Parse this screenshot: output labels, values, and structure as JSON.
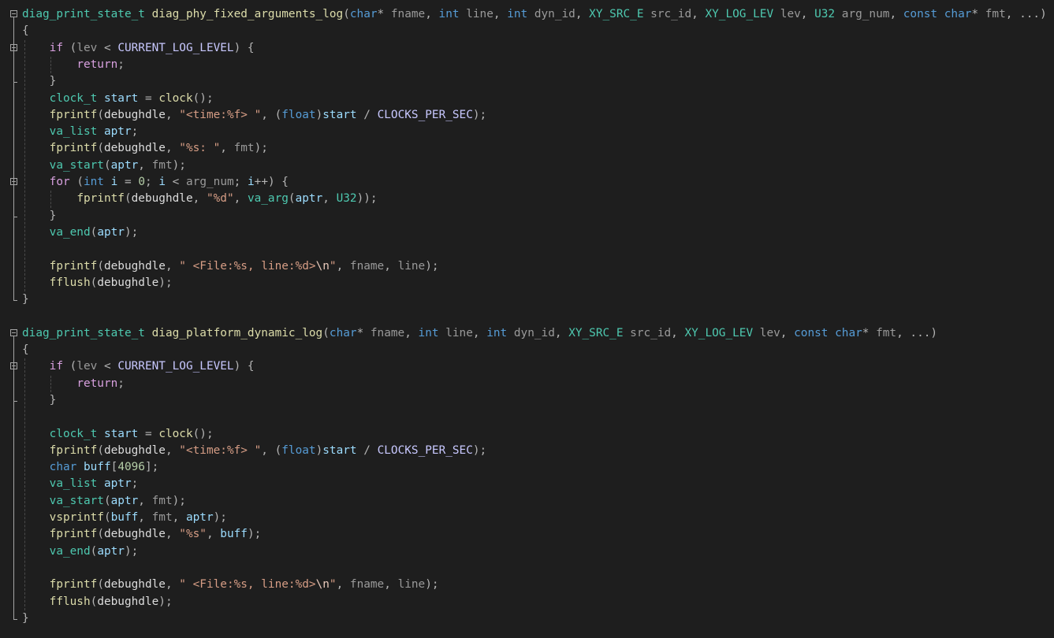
{
  "editor": {
    "lines": [
      [
        [
          "type",
          "diag_print_state_t"
        ],
        [
          "pl",
          " "
        ],
        [
          "fn",
          "diag_phy_fixed_arguments_log"
        ],
        [
          "op",
          "("
        ],
        [
          "kw",
          "char"
        ],
        [
          "op",
          "* "
        ],
        [
          "par",
          "fname"
        ],
        [
          "op",
          ", "
        ],
        [
          "kw",
          "int"
        ],
        [
          "op",
          " "
        ],
        [
          "par",
          "line"
        ],
        [
          "op",
          ", "
        ],
        [
          "kw",
          "int"
        ],
        [
          "op",
          " "
        ],
        [
          "par",
          "dyn_id"
        ],
        [
          "op",
          ", "
        ],
        [
          "type",
          "XY_SRC_E"
        ],
        [
          "op",
          " "
        ],
        [
          "par",
          "src_id"
        ],
        [
          "op",
          ", "
        ],
        [
          "type",
          "XY_LOG_LEV"
        ],
        [
          "op",
          " "
        ],
        [
          "par",
          "lev"
        ],
        [
          "op",
          ", "
        ],
        [
          "type",
          "U32"
        ],
        [
          "op",
          " "
        ],
        [
          "par",
          "arg_num"
        ],
        [
          "op",
          ", "
        ],
        [
          "kw",
          "const"
        ],
        [
          "op",
          " "
        ],
        [
          "kw",
          "char"
        ],
        [
          "op",
          "* "
        ],
        [
          "par",
          "fmt"
        ],
        [
          "op",
          ", ...)"
        ]
      ],
      [
        [
          "op",
          "{"
        ]
      ],
      [
        [
          "pl",
          "    "
        ],
        [
          "kw2",
          "if"
        ],
        [
          "op",
          " ("
        ],
        [
          "par",
          "lev"
        ],
        [
          "op",
          " < "
        ],
        [
          "mac",
          "CURRENT_LOG_LEVEL"
        ],
        [
          "op",
          ") {"
        ]
      ],
      [
        [
          "pl",
          "        "
        ],
        [
          "kw2",
          "return"
        ],
        [
          "op",
          ";"
        ]
      ],
      [
        [
          "pl",
          "    "
        ],
        [
          "op",
          "}"
        ]
      ],
      [
        [
          "pl",
          "    "
        ],
        [
          "type",
          "clock_t"
        ],
        [
          "pl",
          " "
        ],
        [
          "var",
          "start"
        ],
        [
          "op",
          " = "
        ],
        [
          "fn",
          "clock"
        ],
        [
          "op",
          "();"
        ]
      ],
      [
        [
          "pl",
          "    "
        ],
        [
          "fn",
          "fprintf"
        ],
        [
          "op",
          "("
        ],
        [
          "pl",
          "debughdle"
        ],
        [
          "op",
          ", "
        ],
        [
          "str",
          "\"<time:%f> \""
        ],
        [
          "op",
          ", ("
        ],
        [
          "kw",
          "float"
        ],
        [
          "op",
          ")"
        ],
        [
          "var",
          "start"
        ],
        [
          "op",
          " / "
        ],
        [
          "mac",
          "CLOCKS_PER_SEC"
        ],
        [
          "op",
          ");"
        ]
      ],
      [
        [
          "pl",
          "    "
        ],
        [
          "type",
          "va_list"
        ],
        [
          "pl",
          " "
        ],
        [
          "var",
          "aptr"
        ],
        [
          "op",
          ";"
        ]
      ],
      [
        [
          "pl",
          "    "
        ],
        [
          "fn",
          "fprintf"
        ],
        [
          "op",
          "("
        ],
        [
          "pl",
          "debughdle"
        ],
        [
          "op",
          ", "
        ],
        [
          "str",
          "\"%s: \""
        ],
        [
          "op",
          ", "
        ],
        [
          "par",
          "fmt"
        ],
        [
          "op",
          ");"
        ]
      ],
      [
        [
          "pl",
          "    "
        ],
        [
          "type",
          "va_start"
        ],
        [
          "op",
          "("
        ],
        [
          "var",
          "aptr"
        ],
        [
          "op",
          ", "
        ],
        [
          "par",
          "fmt"
        ],
        [
          "op",
          ");"
        ]
      ],
      [
        [
          "pl",
          "    "
        ],
        [
          "kw2",
          "for"
        ],
        [
          "op",
          " ("
        ],
        [
          "kw",
          "int"
        ],
        [
          "pl",
          " "
        ],
        [
          "var",
          "i"
        ],
        [
          "op",
          " = "
        ],
        [
          "num",
          "0"
        ],
        [
          "op",
          "; "
        ],
        [
          "var",
          "i"
        ],
        [
          "op",
          " < "
        ],
        [
          "par",
          "arg_num"
        ],
        [
          "op",
          "; "
        ],
        [
          "var",
          "i"
        ],
        [
          "op",
          "++) {"
        ]
      ],
      [
        [
          "pl",
          "        "
        ],
        [
          "fn",
          "fprintf"
        ],
        [
          "op",
          "("
        ],
        [
          "pl",
          "debughdle"
        ],
        [
          "op",
          ", "
        ],
        [
          "str",
          "\"%d\""
        ],
        [
          "op",
          ", "
        ],
        [
          "type",
          "va_arg"
        ],
        [
          "op",
          "("
        ],
        [
          "var",
          "aptr"
        ],
        [
          "op",
          ", "
        ],
        [
          "type",
          "U32"
        ],
        [
          "op",
          "));"
        ]
      ],
      [
        [
          "pl",
          "    "
        ],
        [
          "op",
          "}"
        ]
      ],
      [
        [
          "pl",
          "    "
        ],
        [
          "type",
          "va_end"
        ],
        [
          "op",
          "("
        ],
        [
          "var",
          "aptr"
        ],
        [
          "op",
          ");"
        ]
      ],
      [],
      [
        [
          "pl",
          "    "
        ],
        [
          "fn",
          "fprintf"
        ],
        [
          "op",
          "("
        ],
        [
          "pl",
          "debughdle"
        ],
        [
          "op",
          ", "
        ],
        [
          "str",
          "\" <File:%s, line:%d>"
        ],
        [
          "esc",
          "\\n"
        ],
        [
          "str",
          "\""
        ],
        [
          "op",
          ", "
        ],
        [
          "par",
          "fname"
        ],
        [
          "op",
          ", "
        ],
        [
          "par",
          "line"
        ],
        [
          "op",
          ");"
        ]
      ],
      [
        [
          "pl",
          "    "
        ],
        [
          "fn",
          "fflush"
        ],
        [
          "op",
          "("
        ],
        [
          "pl",
          "debughdle"
        ],
        [
          "op",
          ");"
        ]
      ],
      [
        [
          "op",
          "}"
        ]
      ],
      [],
      [
        [
          "type",
          "diag_print_state_t"
        ],
        [
          "pl",
          " "
        ],
        [
          "fn",
          "diag_platform_dynamic_log"
        ],
        [
          "op",
          "("
        ],
        [
          "kw",
          "char"
        ],
        [
          "op",
          "* "
        ],
        [
          "par",
          "fname"
        ],
        [
          "op",
          ", "
        ],
        [
          "kw",
          "int"
        ],
        [
          "op",
          " "
        ],
        [
          "par",
          "line"
        ],
        [
          "op",
          ", "
        ],
        [
          "kw",
          "int"
        ],
        [
          "op",
          " "
        ],
        [
          "par",
          "dyn_id"
        ],
        [
          "op",
          ", "
        ],
        [
          "type",
          "XY_SRC_E"
        ],
        [
          "op",
          " "
        ],
        [
          "par",
          "src_id"
        ],
        [
          "op",
          ", "
        ],
        [
          "type",
          "XY_LOG_LEV"
        ],
        [
          "op",
          " "
        ],
        [
          "par",
          "lev"
        ],
        [
          "op",
          ", "
        ],
        [
          "kw",
          "const"
        ],
        [
          "op",
          " "
        ],
        [
          "kw",
          "char"
        ],
        [
          "op",
          "* "
        ],
        [
          "par",
          "fmt"
        ],
        [
          "op",
          ", ...)"
        ]
      ],
      [
        [
          "op",
          "{"
        ]
      ],
      [
        [
          "pl",
          "    "
        ],
        [
          "kw2",
          "if"
        ],
        [
          "op",
          " ("
        ],
        [
          "par",
          "lev"
        ],
        [
          "op",
          " < "
        ],
        [
          "mac",
          "CURRENT_LOG_LEVEL"
        ],
        [
          "op",
          ") {"
        ]
      ],
      [
        [
          "pl",
          "        "
        ],
        [
          "kw2",
          "return"
        ],
        [
          "op",
          ";"
        ]
      ],
      [
        [
          "pl",
          "    "
        ],
        [
          "op",
          "}"
        ]
      ],
      [],
      [
        [
          "pl",
          "    "
        ],
        [
          "type",
          "clock_t"
        ],
        [
          "pl",
          " "
        ],
        [
          "var",
          "start"
        ],
        [
          "op",
          " = "
        ],
        [
          "fn",
          "clock"
        ],
        [
          "op",
          "();"
        ]
      ],
      [
        [
          "pl",
          "    "
        ],
        [
          "fn",
          "fprintf"
        ],
        [
          "op",
          "("
        ],
        [
          "pl",
          "debughdle"
        ],
        [
          "op",
          ", "
        ],
        [
          "str",
          "\"<time:%f> \""
        ],
        [
          "op",
          ", ("
        ],
        [
          "kw",
          "float"
        ],
        [
          "op",
          ")"
        ],
        [
          "var",
          "start"
        ],
        [
          "op",
          " / "
        ],
        [
          "mac",
          "CLOCKS_PER_SEC"
        ],
        [
          "op",
          ");"
        ]
      ],
      [
        [
          "pl",
          "    "
        ],
        [
          "kw",
          "char"
        ],
        [
          "pl",
          " "
        ],
        [
          "var",
          "buff"
        ],
        [
          "op",
          "["
        ],
        [
          "num",
          "4096"
        ],
        [
          "op",
          "];"
        ]
      ],
      [
        [
          "pl",
          "    "
        ],
        [
          "type",
          "va_list"
        ],
        [
          "pl",
          " "
        ],
        [
          "var",
          "aptr"
        ],
        [
          "op",
          ";"
        ]
      ],
      [
        [
          "pl",
          "    "
        ],
        [
          "type",
          "va_start"
        ],
        [
          "op",
          "("
        ],
        [
          "var",
          "aptr"
        ],
        [
          "op",
          ", "
        ],
        [
          "par",
          "fmt"
        ],
        [
          "op",
          ");"
        ]
      ],
      [
        [
          "pl",
          "    "
        ],
        [
          "fn",
          "vsprintf"
        ],
        [
          "op",
          "("
        ],
        [
          "var",
          "buff"
        ],
        [
          "op",
          ", "
        ],
        [
          "par",
          "fmt"
        ],
        [
          "op",
          ", "
        ],
        [
          "var",
          "aptr"
        ],
        [
          "op",
          ");"
        ]
      ],
      [
        [
          "pl",
          "    "
        ],
        [
          "fn",
          "fprintf"
        ],
        [
          "op",
          "("
        ],
        [
          "pl",
          "debughdle"
        ],
        [
          "op",
          ", "
        ],
        [
          "str",
          "\"%s\""
        ],
        [
          "op",
          ", "
        ],
        [
          "var",
          "buff"
        ],
        [
          "op",
          ");"
        ]
      ],
      [
        [
          "pl",
          "    "
        ],
        [
          "type",
          "va_end"
        ],
        [
          "op",
          "("
        ],
        [
          "var",
          "aptr"
        ],
        [
          "op",
          ");"
        ]
      ],
      [],
      [
        [
          "pl",
          "    "
        ],
        [
          "fn",
          "fprintf"
        ],
        [
          "op",
          "("
        ],
        [
          "pl",
          "debughdle"
        ],
        [
          "op",
          ", "
        ],
        [
          "str",
          "\" <File:%s, line:%d>"
        ],
        [
          "esc",
          "\\n"
        ],
        [
          "str",
          "\""
        ],
        [
          "op",
          ", "
        ],
        [
          "par",
          "fname"
        ],
        [
          "op",
          ", "
        ],
        [
          "par",
          "line"
        ],
        [
          "op",
          ");"
        ]
      ],
      [
        [
          "pl",
          "    "
        ],
        [
          "fn",
          "fflush"
        ],
        [
          "op",
          "("
        ],
        [
          "pl",
          "debughdle"
        ],
        [
          "op",
          ");"
        ]
      ],
      [
        [
          "op",
          "}"
        ]
      ]
    ],
    "theme": {
      "background": "#1e1e1e",
      "keyword": "#569cd6",
      "control_keyword": "#d8a0df",
      "type": "#4ec9b0",
      "function": "#dcdcaa",
      "local_variable": "#9cdcfe",
      "parameter": "#9a9a9a",
      "string": "#d69d85",
      "number": "#b5cea8",
      "macro": "#c8c8ff",
      "fold_marker": "#a5a5a5"
    }
  }
}
